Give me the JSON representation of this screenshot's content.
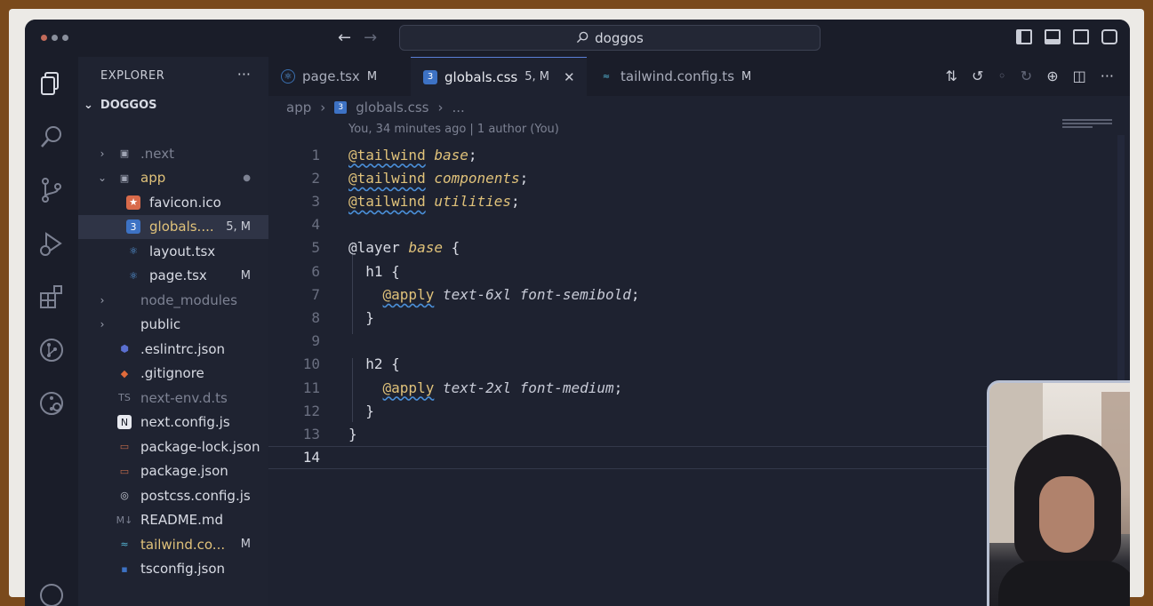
{
  "titlebar": {
    "search": "doggos"
  },
  "sidebar": {
    "header": "EXPLORER",
    "more": "···",
    "root": "DOGGOS",
    "items": [
      {
        "label": ".next",
        "badge": "",
        "depth": 0,
        "folder": true,
        "icon": "next-folder-icon",
        "dim": true
      },
      {
        "label": "app",
        "badge": "●",
        "depth": 0,
        "folder": true,
        "open": true,
        "icon": "app-folder-icon",
        "mod": true
      },
      {
        "label": "favicon.ico",
        "badge": "",
        "depth": 1,
        "icon": "favicon-icon"
      },
      {
        "label": "globals....",
        "badge": "5, M",
        "depth": 1,
        "icon": "css-icon",
        "mod": true,
        "selected": true
      },
      {
        "label": "layout.tsx",
        "badge": "",
        "depth": 1,
        "icon": "react-icon"
      },
      {
        "label": "page.tsx",
        "badge": "M",
        "depth": 1,
        "icon": "react-icon"
      },
      {
        "label": "node_modules",
        "badge": "",
        "depth": 0,
        "folder": true,
        "icon": "folder-icon",
        "dim": true
      },
      {
        "label": "public",
        "badge": "",
        "depth": 0,
        "folder": true,
        "icon": "folder-icon"
      },
      {
        "label": ".eslintrc.json",
        "badge": "",
        "depth": 0,
        "icon": "eslint-icon"
      },
      {
        "label": ".gitignore",
        "badge": "",
        "depth": 0,
        "icon": "git-icon"
      },
      {
        "label": "next-env.d.ts",
        "badge": "",
        "depth": 0,
        "icon": "ts-icon",
        "dim": true
      },
      {
        "label": "next.config.js",
        "badge": "",
        "depth": 0,
        "icon": "next-icon"
      },
      {
        "label": "package-lock.json",
        "badge": "",
        "depth": 0,
        "icon": "npm-icon"
      },
      {
        "label": "package.json",
        "badge": "",
        "depth": 0,
        "icon": "npm-icon"
      },
      {
        "label": "postcss.config.js",
        "badge": "",
        "depth": 0,
        "icon": "postcss-icon"
      },
      {
        "label": "README.md",
        "badge": "",
        "depth": 0,
        "icon": "markdown-icon"
      },
      {
        "label": "tailwind.co...",
        "badge": "M",
        "depth": 0,
        "icon": "tailwind-icon",
        "mod": true
      },
      {
        "label": "tsconfig.json",
        "badge": "",
        "depth": 0,
        "icon": "tsconfig-icon"
      }
    ]
  },
  "tabs": [
    {
      "label": "page.tsx",
      "badge": "M",
      "icon": "react-icon"
    },
    {
      "label": "globals.css",
      "badge": "5, M",
      "icon": "css-icon",
      "active": true,
      "close": "✕"
    },
    {
      "label": "tailwind.config.ts",
      "badge": "M",
      "icon": "tailwind-icon"
    }
  ],
  "breadcrumb": {
    "folder": "app",
    "file": "globals.css",
    "more": "..."
  },
  "blame": "You, 34 minutes ago | 1 author (You)",
  "code": [
    {
      "n": "1",
      "parts": [
        [
          "kw",
          "@tailwind"
        ],
        [
          "p",
          " "
        ],
        [
          "it",
          "base"
        ],
        [
          "p",
          ";"
        ]
      ]
    },
    {
      "n": "2",
      "parts": [
        [
          "kw",
          "@tailwind"
        ],
        [
          "p",
          " "
        ],
        [
          "it",
          "components"
        ],
        [
          "p",
          ";"
        ]
      ]
    },
    {
      "n": "3",
      "parts": [
        [
          "kw",
          "@tailwind"
        ],
        [
          "p",
          " "
        ],
        [
          "it",
          "utilities"
        ],
        [
          "p",
          ";"
        ]
      ]
    },
    {
      "n": "4",
      "parts": []
    },
    {
      "n": "5",
      "parts": [
        [
          "p",
          "@layer "
        ],
        [
          "it",
          "base"
        ],
        [
          "p",
          " {"
        ]
      ]
    },
    {
      "n": "6",
      "parts": [
        [
          "p",
          "  h1 {"
        ]
      ]
    },
    {
      "n": "7",
      "parts": [
        [
          "p",
          "    "
        ],
        [
          "kw",
          "@apply"
        ],
        [
          "p",
          " "
        ],
        [
          "it2",
          "text-6xl font-semibold"
        ],
        [
          "p",
          ";"
        ]
      ]
    },
    {
      "n": "8",
      "parts": [
        [
          "p",
          "  }"
        ]
      ]
    },
    {
      "n": "9",
      "parts": []
    },
    {
      "n": "10",
      "parts": [
        [
          "p",
          "  h2 {"
        ]
      ]
    },
    {
      "n": "11",
      "parts": [
        [
          "p",
          "    "
        ],
        [
          "kw",
          "@apply"
        ],
        [
          "p",
          " "
        ],
        [
          "it2",
          "text-2xl font-medium"
        ],
        [
          "p",
          ";"
        ]
      ]
    },
    {
      "n": "12",
      "parts": [
        [
          "p",
          "  }"
        ]
      ]
    },
    {
      "n": "13",
      "parts": [
        [
          "p",
          "}"
        ]
      ]
    },
    {
      "n": "14",
      "parts": [],
      "current": true
    }
  ]
}
